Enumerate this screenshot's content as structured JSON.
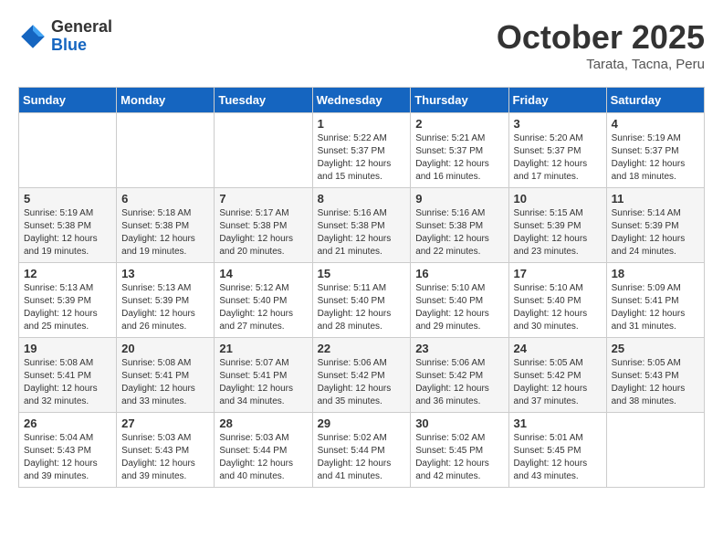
{
  "header": {
    "logo_general": "General",
    "logo_blue": "Blue",
    "month": "October 2025",
    "location": "Tarata, Tacna, Peru"
  },
  "days_of_week": [
    "Sunday",
    "Monday",
    "Tuesday",
    "Wednesday",
    "Thursday",
    "Friday",
    "Saturday"
  ],
  "weeks": [
    [
      {
        "day": "",
        "info": ""
      },
      {
        "day": "",
        "info": ""
      },
      {
        "day": "",
        "info": ""
      },
      {
        "day": "1",
        "info": "Sunrise: 5:22 AM\nSunset: 5:37 PM\nDaylight: 12 hours\nand 15 minutes."
      },
      {
        "day": "2",
        "info": "Sunrise: 5:21 AM\nSunset: 5:37 PM\nDaylight: 12 hours\nand 16 minutes."
      },
      {
        "day": "3",
        "info": "Sunrise: 5:20 AM\nSunset: 5:37 PM\nDaylight: 12 hours\nand 17 minutes."
      },
      {
        "day": "4",
        "info": "Sunrise: 5:19 AM\nSunset: 5:37 PM\nDaylight: 12 hours\nand 18 minutes."
      }
    ],
    [
      {
        "day": "5",
        "info": "Sunrise: 5:19 AM\nSunset: 5:38 PM\nDaylight: 12 hours\nand 19 minutes."
      },
      {
        "day": "6",
        "info": "Sunrise: 5:18 AM\nSunset: 5:38 PM\nDaylight: 12 hours\nand 19 minutes."
      },
      {
        "day": "7",
        "info": "Sunrise: 5:17 AM\nSunset: 5:38 PM\nDaylight: 12 hours\nand 20 minutes."
      },
      {
        "day": "8",
        "info": "Sunrise: 5:16 AM\nSunset: 5:38 PM\nDaylight: 12 hours\nand 21 minutes."
      },
      {
        "day": "9",
        "info": "Sunrise: 5:16 AM\nSunset: 5:38 PM\nDaylight: 12 hours\nand 22 minutes."
      },
      {
        "day": "10",
        "info": "Sunrise: 5:15 AM\nSunset: 5:39 PM\nDaylight: 12 hours\nand 23 minutes."
      },
      {
        "day": "11",
        "info": "Sunrise: 5:14 AM\nSunset: 5:39 PM\nDaylight: 12 hours\nand 24 minutes."
      }
    ],
    [
      {
        "day": "12",
        "info": "Sunrise: 5:13 AM\nSunset: 5:39 PM\nDaylight: 12 hours\nand 25 minutes."
      },
      {
        "day": "13",
        "info": "Sunrise: 5:13 AM\nSunset: 5:39 PM\nDaylight: 12 hours\nand 26 minutes."
      },
      {
        "day": "14",
        "info": "Sunrise: 5:12 AM\nSunset: 5:40 PM\nDaylight: 12 hours\nand 27 minutes."
      },
      {
        "day": "15",
        "info": "Sunrise: 5:11 AM\nSunset: 5:40 PM\nDaylight: 12 hours\nand 28 minutes."
      },
      {
        "day": "16",
        "info": "Sunrise: 5:10 AM\nSunset: 5:40 PM\nDaylight: 12 hours\nand 29 minutes."
      },
      {
        "day": "17",
        "info": "Sunrise: 5:10 AM\nSunset: 5:40 PM\nDaylight: 12 hours\nand 30 minutes."
      },
      {
        "day": "18",
        "info": "Sunrise: 5:09 AM\nSunset: 5:41 PM\nDaylight: 12 hours\nand 31 minutes."
      }
    ],
    [
      {
        "day": "19",
        "info": "Sunrise: 5:08 AM\nSunset: 5:41 PM\nDaylight: 12 hours\nand 32 minutes."
      },
      {
        "day": "20",
        "info": "Sunrise: 5:08 AM\nSunset: 5:41 PM\nDaylight: 12 hours\nand 33 minutes."
      },
      {
        "day": "21",
        "info": "Sunrise: 5:07 AM\nSunset: 5:41 PM\nDaylight: 12 hours\nand 34 minutes."
      },
      {
        "day": "22",
        "info": "Sunrise: 5:06 AM\nSunset: 5:42 PM\nDaylight: 12 hours\nand 35 minutes."
      },
      {
        "day": "23",
        "info": "Sunrise: 5:06 AM\nSunset: 5:42 PM\nDaylight: 12 hours\nand 36 minutes."
      },
      {
        "day": "24",
        "info": "Sunrise: 5:05 AM\nSunset: 5:42 PM\nDaylight: 12 hours\nand 37 minutes."
      },
      {
        "day": "25",
        "info": "Sunrise: 5:05 AM\nSunset: 5:43 PM\nDaylight: 12 hours\nand 38 minutes."
      }
    ],
    [
      {
        "day": "26",
        "info": "Sunrise: 5:04 AM\nSunset: 5:43 PM\nDaylight: 12 hours\nand 39 minutes."
      },
      {
        "day": "27",
        "info": "Sunrise: 5:03 AM\nSunset: 5:43 PM\nDaylight: 12 hours\nand 39 minutes."
      },
      {
        "day": "28",
        "info": "Sunrise: 5:03 AM\nSunset: 5:44 PM\nDaylight: 12 hours\nand 40 minutes."
      },
      {
        "day": "29",
        "info": "Sunrise: 5:02 AM\nSunset: 5:44 PM\nDaylight: 12 hours\nand 41 minutes."
      },
      {
        "day": "30",
        "info": "Sunrise: 5:02 AM\nSunset: 5:45 PM\nDaylight: 12 hours\nand 42 minutes."
      },
      {
        "day": "31",
        "info": "Sunrise: 5:01 AM\nSunset: 5:45 PM\nDaylight: 12 hours\nand 43 minutes."
      },
      {
        "day": "",
        "info": ""
      }
    ]
  ]
}
